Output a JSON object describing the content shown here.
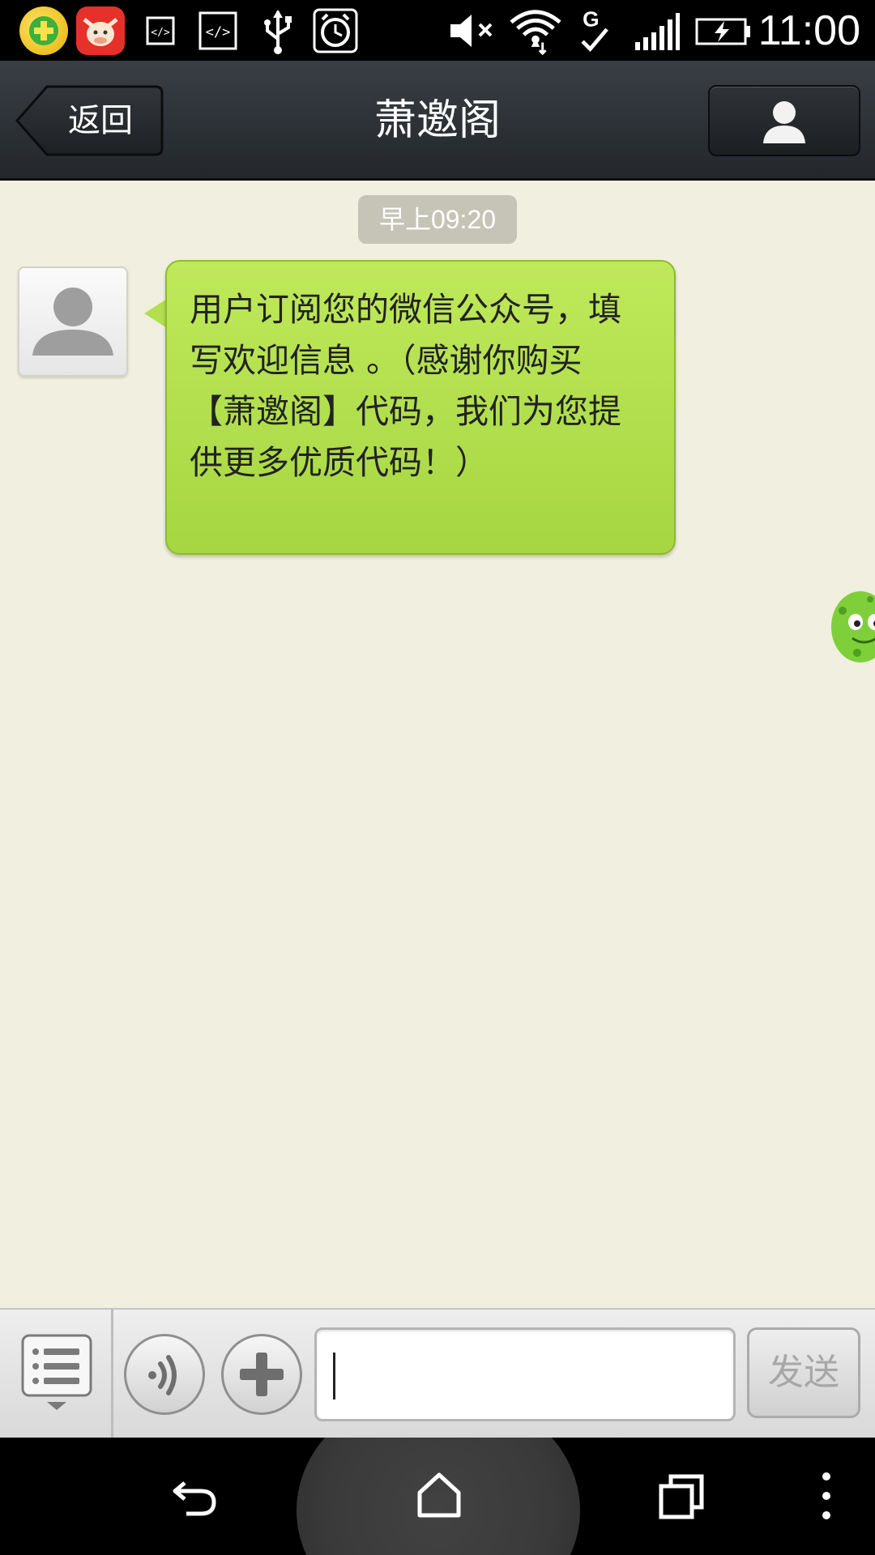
{
  "status_bar": {
    "time": "11:00",
    "icons": [
      "security-app-icon",
      "cow-app-icon",
      "code-icon",
      "code-icon",
      "usb-icon",
      "alarm-icon",
      "mute-icon",
      "wifi-icon",
      "g-data-icon",
      "signal-icon",
      "battery-charging-icon"
    ]
  },
  "header": {
    "back_label": "返回",
    "title": "萧邀阁",
    "profile_icon": "person-icon"
  },
  "chat": {
    "timestamp": "早上09:20",
    "messages": [
      {
        "sender": "received",
        "avatar_icon": "default-avatar-icon",
        "text": "用户订阅您的微信公众号，填写欢迎信息 。（感谢你购买【萧邀阁】代码，我们为您提供更多优质代码！）"
      }
    ]
  },
  "input_bar": {
    "menu_icon": "list-menu-icon",
    "voice_icon": "voice-icon",
    "plus_icon": "plus-icon",
    "input_value": "",
    "input_placeholder": "",
    "send_label": "发送"
  },
  "nav_bar": {
    "icons": [
      "back-arrow-icon",
      "home-icon",
      "recent-apps-icon",
      "more-options-icon"
    ]
  },
  "colors": {
    "chat_background": "#f1efdf",
    "bubble_green": "#b3df4e",
    "header_dark": "#2a2e33"
  }
}
